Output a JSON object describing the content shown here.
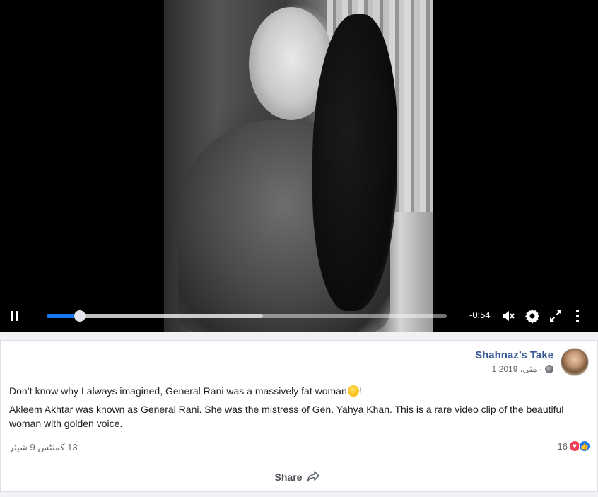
{
  "video": {
    "time_remaining": "-0:54",
    "progress_fraction": 0.083,
    "buffered_fraction": 0.54,
    "icons": [
      "pause-icon",
      "volume-muted-icon",
      "settings-gear-icon",
      "fullscreen-icon",
      "more-options-icon"
    ]
  },
  "post": {
    "author": "Shahnaz’s Take",
    "date": "1 مئی، 2019 ·",
    "text_line1_prefix": "Don’t know why I always imagined, General Rani was a massively fat woman",
    "text_line1_suffix": "!",
    "text_paragraph2": "Akleem Akhtar was known as General Rani. She was the mistress of Gen. Yahya Khan. This is a rare video clip of the beautiful woman with golden voice.",
    "comments_shares": "13 کمنٹس  9 شیئر",
    "reaction_count": "16",
    "share_label": "Share"
  },
  "colors": {
    "accent": "#1877f2",
    "author_link": "#385898",
    "love": "#f33e58"
  }
}
